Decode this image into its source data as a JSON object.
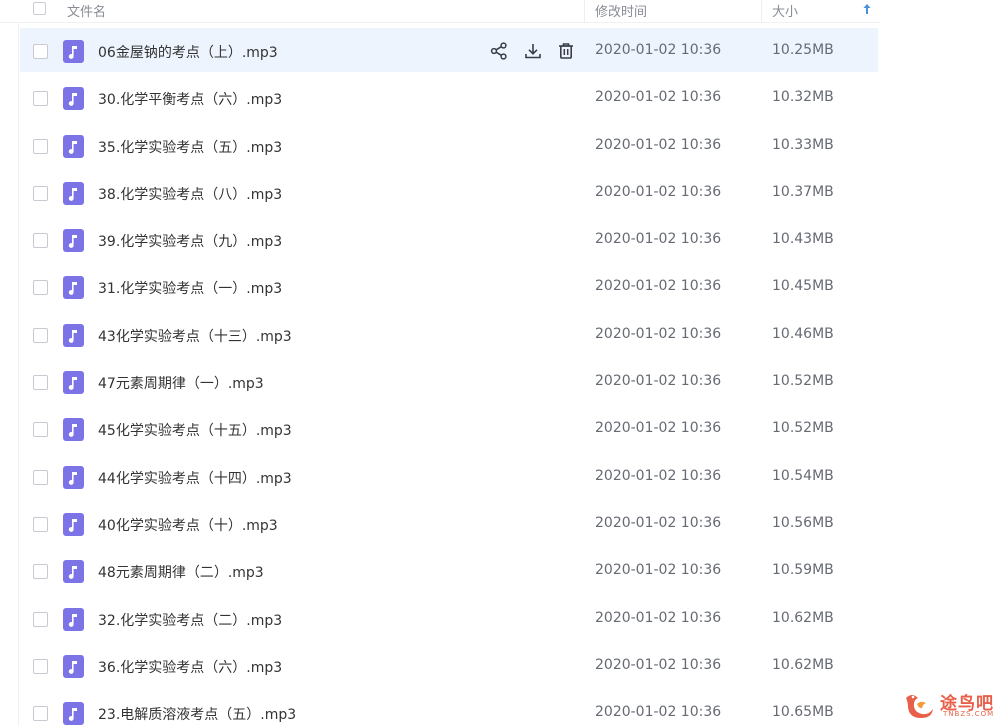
{
  "header": {
    "name_label": "文件名",
    "date_label": "修改时间",
    "size_label": "大小",
    "sort_icon": "sort-ascending-arrow-icon"
  },
  "colors": {
    "accent": "#4a90e2",
    "file_icon": "#7b73e6",
    "active_row": "#edf4fd",
    "watermark": "#e9604a"
  },
  "row_actions": {
    "share_icon": "share-icon",
    "download_icon": "download-icon",
    "delete_icon": "delete-icon"
  },
  "files": [
    {
      "name": "06金屋钠的考点（上）.mp3",
      "modified": "2020-01-02 10:36",
      "size": "10.25MB",
      "hovered": true
    },
    {
      "name": "30.化学平衡考点（六）.mp3",
      "modified": "2020-01-02 10:36",
      "size": "10.32MB"
    },
    {
      "name": "35.化学实验考点（五）.mp3",
      "modified": "2020-01-02 10:36",
      "size": "10.33MB"
    },
    {
      "name": "38.化学实验考点（八）.mp3",
      "modified": "2020-01-02 10:36",
      "size": "10.37MB"
    },
    {
      "name": "39.化学实验考点（九）.mp3",
      "modified": "2020-01-02 10:36",
      "size": "10.43MB"
    },
    {
      "name": "31.化学实验考点（一）.mp3",
      "modified": "2020-01-02 10:36",
      "size": "10.45MB"
    },
    {
      "name": "43化学实验考点（十三）.mp3",
      "modified": "2020-01-02 10:36",
      "size": "10.46MB"
    },
    {
      "name": "47元素周期律（一）.mp3",
      "modified": "2020-01-02 10:36",
      "size": "10.52MB"
    },
    {
      "name": "45化学实验考点（十五）.mp3",
      "modified": "2020-01-02 10:36",
      "size": "10.52MB"
    },
    {
      "name": "44化学实验考点（十四）.mp3",
      "modified": "2020-01-02 10:36",
      "size": "10.54MB"
    },
    {
      "name": "40化学实验考点（十）.mp3",
      "modified": "2020-01-02 10:36",
      "size": "10.56MB"
    },
    {
      "name": "48元素周期律（二）.mp3",
      "modified": "2020-01-02 10:36",
      "size": "10.59MB"
    },
    {
      "name": "32.化学实验考点（二）.mp3",
      "modified": "2020-01-02 10:36",
      "size": "10.62MB"
    },
    {
      "name": "36.化学实验考点（六）.mp3",
      "modified": "2020-01-02 10:36",
      "size": "10.62MB"
    },
    {
      "name": "23.电解质溶液考点（五）.mp3",
      "modified": "2020-01-02 10:36",
      "size": "10.65MB"
    }
  ],
  "watermark": {
    "text": "途鸟吧",
    "subtext": "TNBZS.COM",
    "icon": "bird-logo-icon"
  }
}
